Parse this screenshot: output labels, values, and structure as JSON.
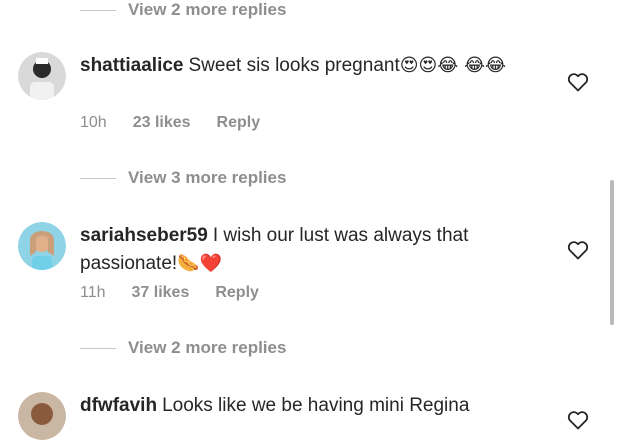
{
  "reply_toggles": [
    {
      "label": "View 2 more replies"
    },
    {
      "label": "View 3 more replies"
    },
    {
      "label": "View 2 more replies"
    }
  ],
  "comments": [
    {
      "username": "shattiaalice",
      "text": "Sweet sis looks pregnant",
      "emojis": "😍😍😂 😂😂",
      "time": "10h",
      "likes": "23 likes",
      "reply": "Reply"
    },
    {
      "username": "sariahseber59",
      "text": "I wish our lust was always that passionate!",
      "emojis": "🌭❤️",
      "time": "11h",
      "likes": "37 likes",
      "reply": "Reply"
    },
    {
      "username": "dfwfavih",
      "text": "Looks like we be having mini Regina",
      "emojis": ""
    }
  ],
  "colors": {
    "text": "#262626",
    "secondary": "#8e8e8e",
    "heart_outline": "#262626"
  },
  "icons": {
    "like": "heart-outline-icon",
    "avatar": "profile-avatar"
  }
}
